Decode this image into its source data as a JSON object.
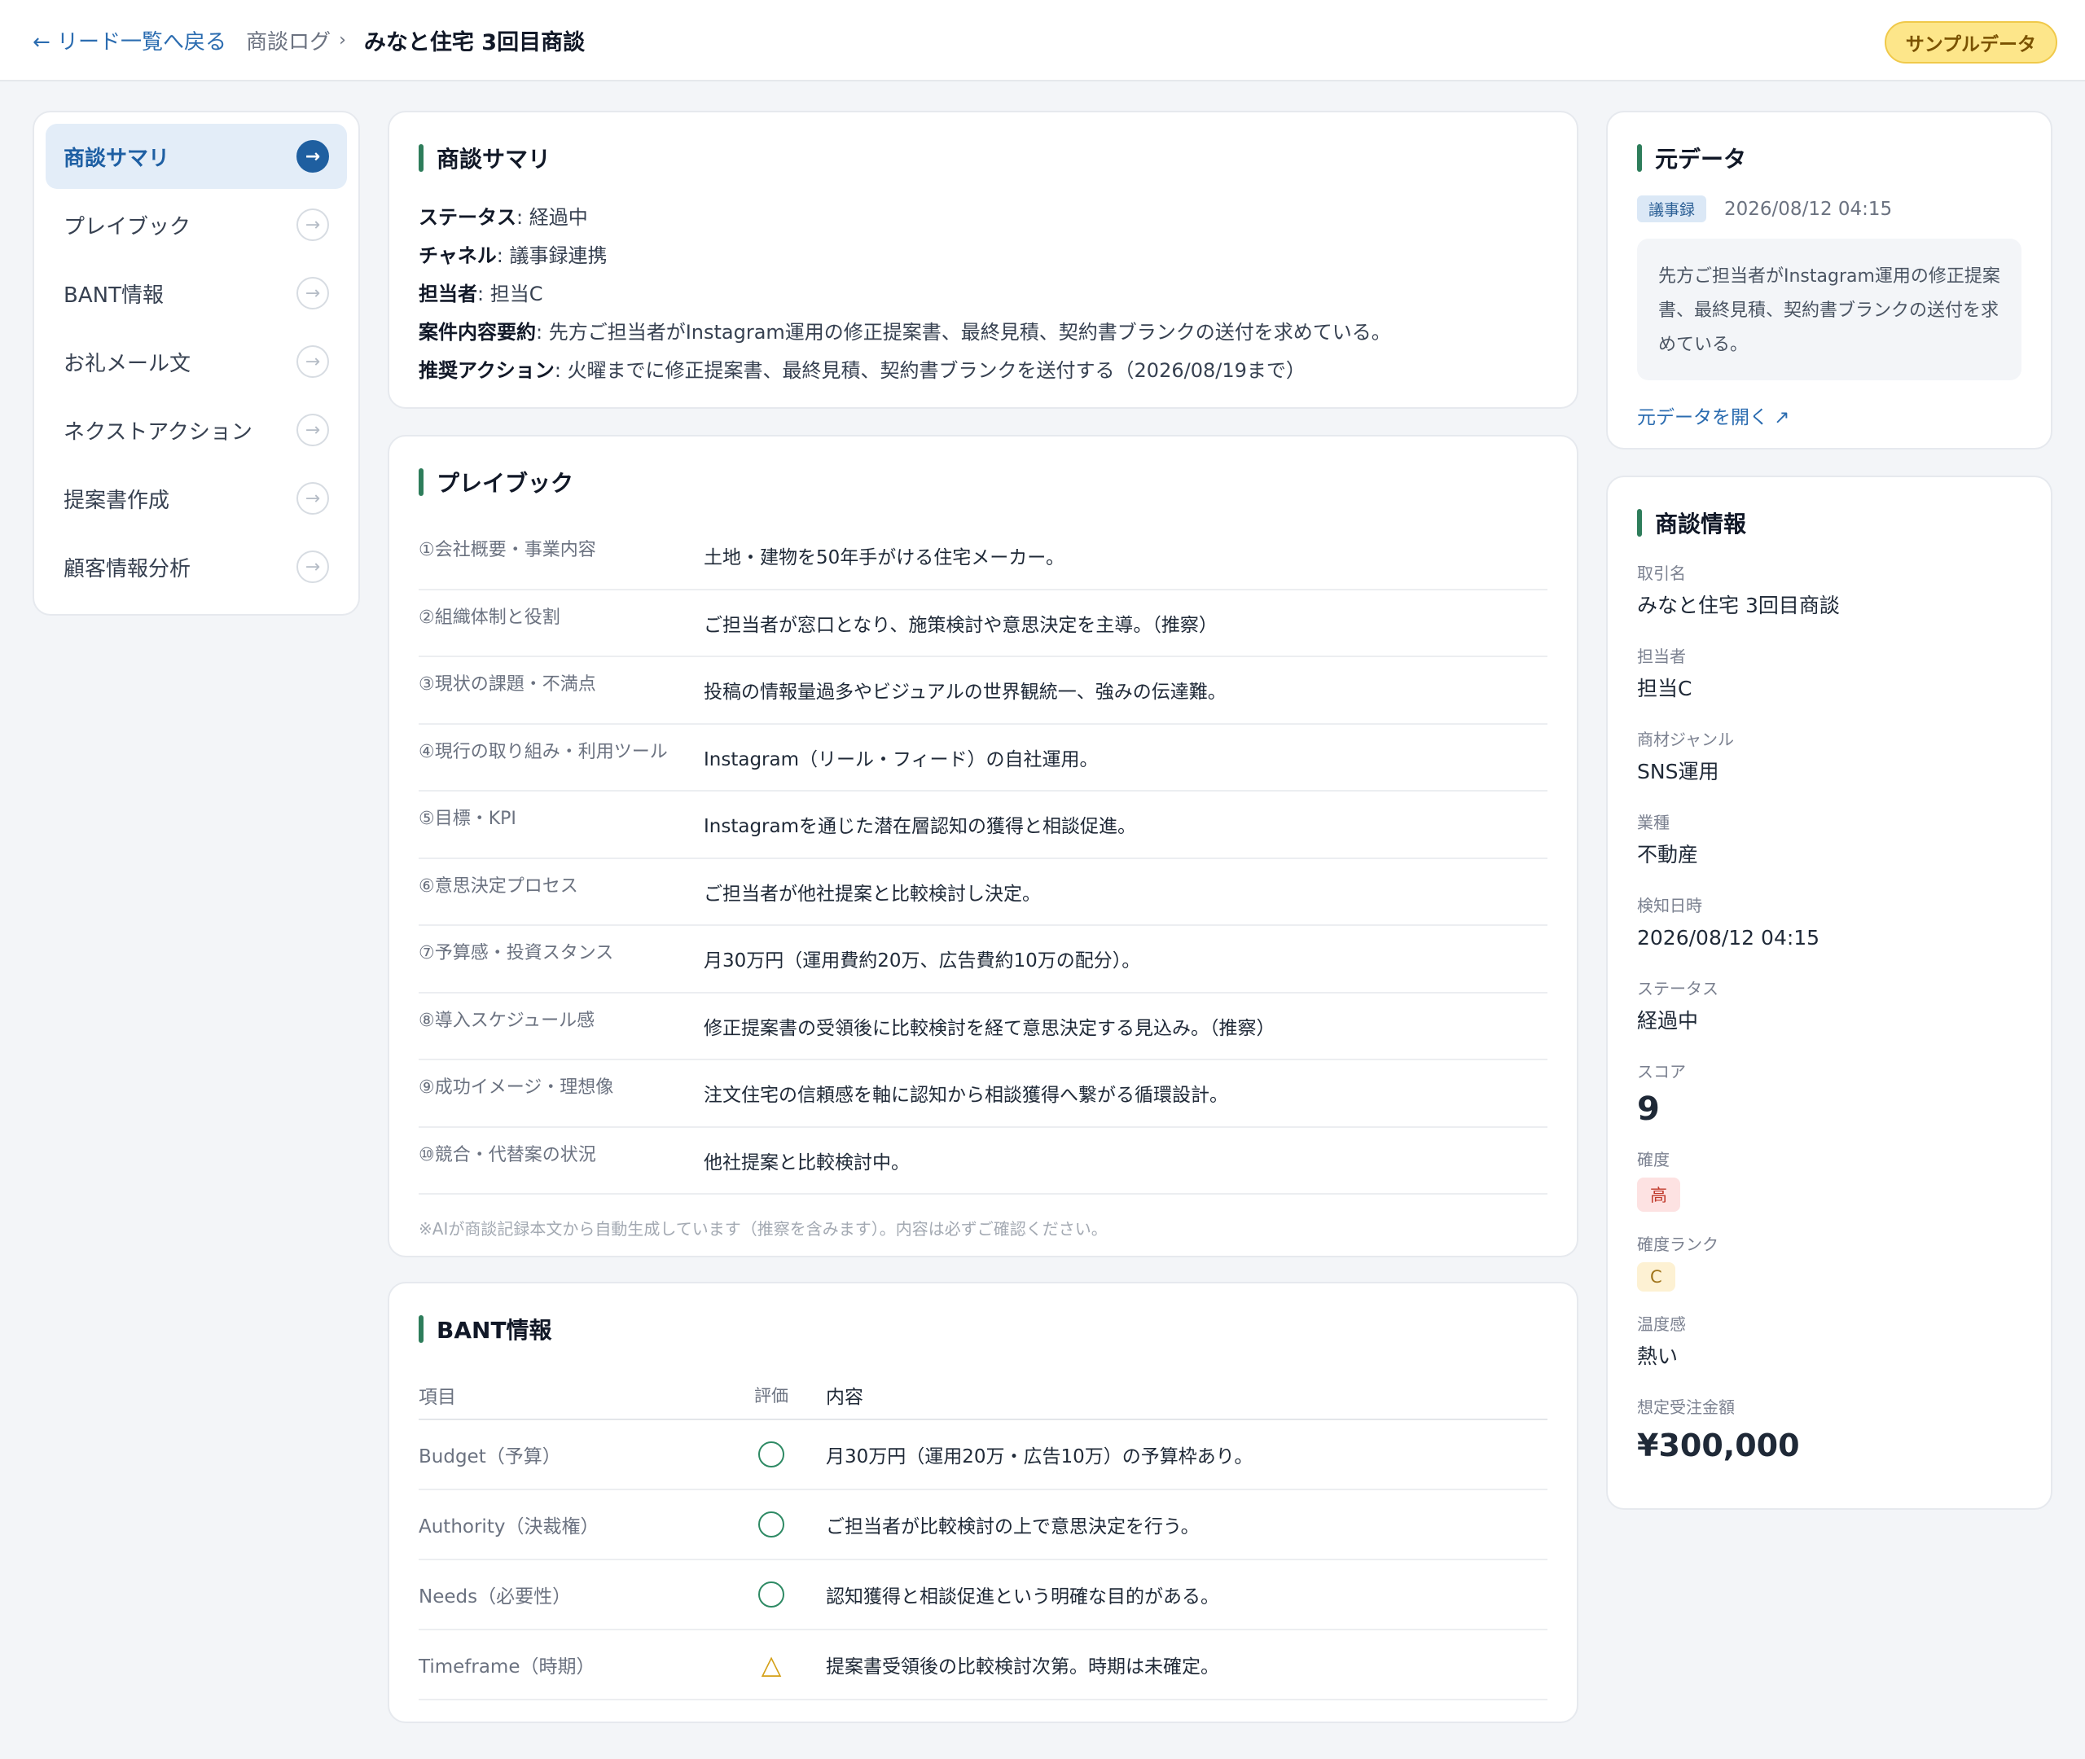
{
  "header": {
    "back_label": "← リード一覧へ戻る",
    "breadcrumb": "商談ログ",
    "breadcrumb_arrow": "›",
    "title": "みなと住宅 3回目商談",
    "badge": "サンプルデータ"
  },
  "sidebar": {
    "items": [
      {
        "label": "商談サマリ",
        "active": true
      },
      {
        "label": "プレイブック"
      },
      {
        "label": "BANT情報"
      },
      {
        "label": "お礼メール文"
      },
      {
        "label": "ネクストアクション"
      },
      {
        "label": "提案書作成"
      },
      {
        "label": "顧客情報分析"
      }
    ],
    "arrow": "→"
  },
  "summary": {
    "heading": "商談サマリ",
    "rows": [
      {
        "key": "ステータス",
        "value": ": 経過中"
      },
      {
        "key": "チャネル",
        "value": ": 議事録連携"
      },
      {
        "key": "担当者",
        "value": ": 担当C"
      },
      {
        "key": "案件内容要約",
        "value": ": 先方ご担当者がInstagram運用の修正提案書、最終見積、契約書ブランクの送付を求めている。"
      },
      {
        "key": "推奨アクション",
        "value": ": 火曜までに修正提案書、最終見積、契約書ブランクを送付する（2026/08/19まで）"
      }
    ]
  },
  "playbook": {
    "heading": "プレイブック",
    "rows": [
      {
        "label": "①会社概要・事業内容",
        "value": "土地・建物を50年手がける住宅メーカー。"
      },
      {
        "label": "②組織体制と役割",
        "value": "ご担当者が窓口となり、施策検討や意思決定を主導。（推察）"
      },
      {
        "label": "③現状の課題・不満点",
        "value": "投稿の情報量過多やビジュアルの世界観統一、強みの伝達難。"
      },
      {
        "label": "④現行の取り組み・利用ツール",
        "value": "Instagram（リール・フィード）の自社運用。"
      },
      {
        "label": "⑤目標・KPI",
        "value": "Instagramを通じた潜在層認知の獲得と相談促進。"
      },
      {
        "label": "⑥意思決定プロセス",
        "value": "ご担当者が他社提案と比較検討し決定。"
      },
      {
        "label": "⑦予算感・投資スタンス",
        "value": "月30万円（運用費約20万、広告費約10万の配分）。"
      },
      {
        "label": "⑧導入スケジュール感",
        "value": "修正提案書の受領後に比較検討を経て意思決定する見込み。（推察）"
      },
      {
        "label": "⑨成功イメージ・理想像",
        "value": "注文住宅の信頼感を軸に認知から相談獲得へ繋がる循環設計。"
      },
      {
        "label": "⑩競合・代替案の状況",
        "value": "他社提案と比較検討中。"
      }
    ],
    "note": "※AIが商談記録本文から自動生成しています（推察を含みます）。内容は必ずご確認ください。"
  },
  "bant": {
    "heading": "BANT情報",
    "columns": {
      "item": "項目",
      "eval": "評価",
      "content": "内容"
    },
    "rows": [
      {
        "item": "Budget（予算）",
        "eval": "circle",
        "content": "月30万円（運用20万・広告10万）の予算枠あり。"
      },
      {
        "item": "Authority（決裁権）",
        "eval": "circle",
        "content": "ご担当者が比較検討の上で意思決定を行う。"
      },
      {
        "item": "Needs（必要性）",
        "eval": "circle",
        "content": "認知獲得と相談促進という明確な目的がある。"
      },
      {
        "item": "Timeframe（時期）",
        "eval": "triangle",
        "content": "提案書受領後の比較検討次第。時期は未確定。"
      }
    ],
    "triangle_glyph": "△"
  },
  "source": {
    "heading": "元データ",
    "tag": "議事録",
    "timestamp": "2026/08/12 04:15",
    "text": "先方ご担当者がInstagram運用の修正提案書、最終見積、契約書ブランクの送付を求めている。",
    "link": "元データを開く ↗"
  },
  "deal": {
    "heading": "商談情報",
    "fields": {
      "deal_name": {
        "label": "取引名",
        "value": "みなと住宅 3回目商談"
      },
      "owner": {
        "label": "担当者",
        "value": "担当C"
      },
      "genre": {
        "label": "商材ジャンル",
        "value": "SNS運用"
      },
      "industry": {
        "label": "業種",
        "value": "不動産"
      },
      "detected": {
        "label": "検知日時",
        "value": "2026/08/12 04:15"
      },
      "status": {
        "label": "ステータス",
        "value": "経過中"
      },
      "score": {
        "label": "スコア",
        "value": "9"
      },
      "certainty": {
        "label": "確度",
        "value": "高"
      },
      "rank": {
        "label": "確度ランク",
        "value": "C"
      },
      "temperature": {
        "label": "温度感",
        "value": "熱い"
      },
      "amount": {
        "label": "想定受注金額",
        "value": "¥300,000"
      }
    }
  },
  "colors": {
    "accent_green": "#2e7d5b",
    "link_blue": "#2b6cb0",
    "active_nav_bg": "#e3edf8",
    "badge_yellow": "#fde68a"
  }
}
